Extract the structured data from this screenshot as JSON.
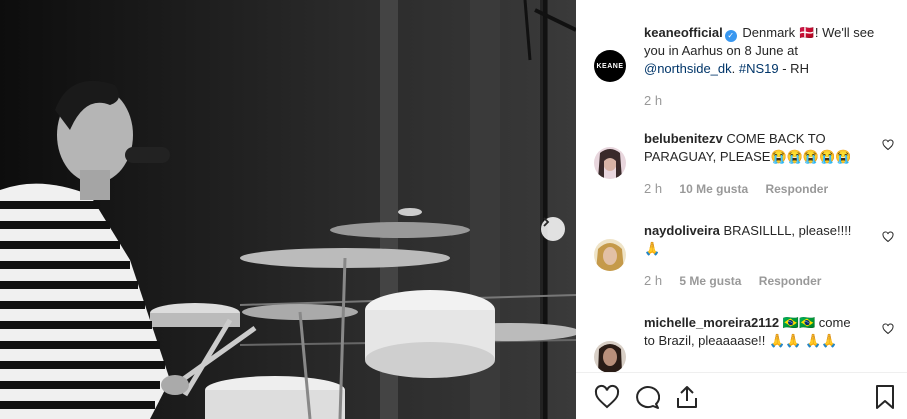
{
  "photo": {
    "alt_subject": "",
    "next_icon": "chevron-right-icon"
  },
  "post": {
    "avatar_text": "KEANE",
    "username": "keaneofficial",
    "verified_icon": "verified-badge-icon",
    "caption_pre": "Denmark 🇩🇰! We'll see you in Aarhus on 8 June at",
    "mention": "@northside_dk",
    "hashtag": "#NS19",
    "caption_post": " - RH",
    "time": "2 h"
  },
  "comments": [
    {
      "username": "belubenitezv",
      "text": "COME BACK TO PARAGUAY, PLEASE😭😭😭😭😭",
      "time": "2 h",
      "likes": "10 Me gusta",
      "reply": "Responder"
    },
    {
      "username": "naydoliveira",
      "text": "BRASILLLL, please!!!! 🙏",
      "time": "2 h",
      "likes": "5 Me gusta",
      "reply": "Responder"
    },
    {
      "username": "michelle_moreira2112",
      "text": "🇧🇷🇧🇷 come to Brazil, pleaaaase!! 🙏🙏 🙏🙏",
      "time": "",
      "likes": "",
      "reply": ""
    }
  ],
  "actions": {
    "like_icon": "heart-icon",
    "comment_icon": "comment-icon",
    "share_icon": "share-icon",
    "save_icon": "bookmark-icon"
  },
  "colors": {
    "verified": "#3897f0",
    "link": "#003569",
    "muted": "#999999"
  }
}
